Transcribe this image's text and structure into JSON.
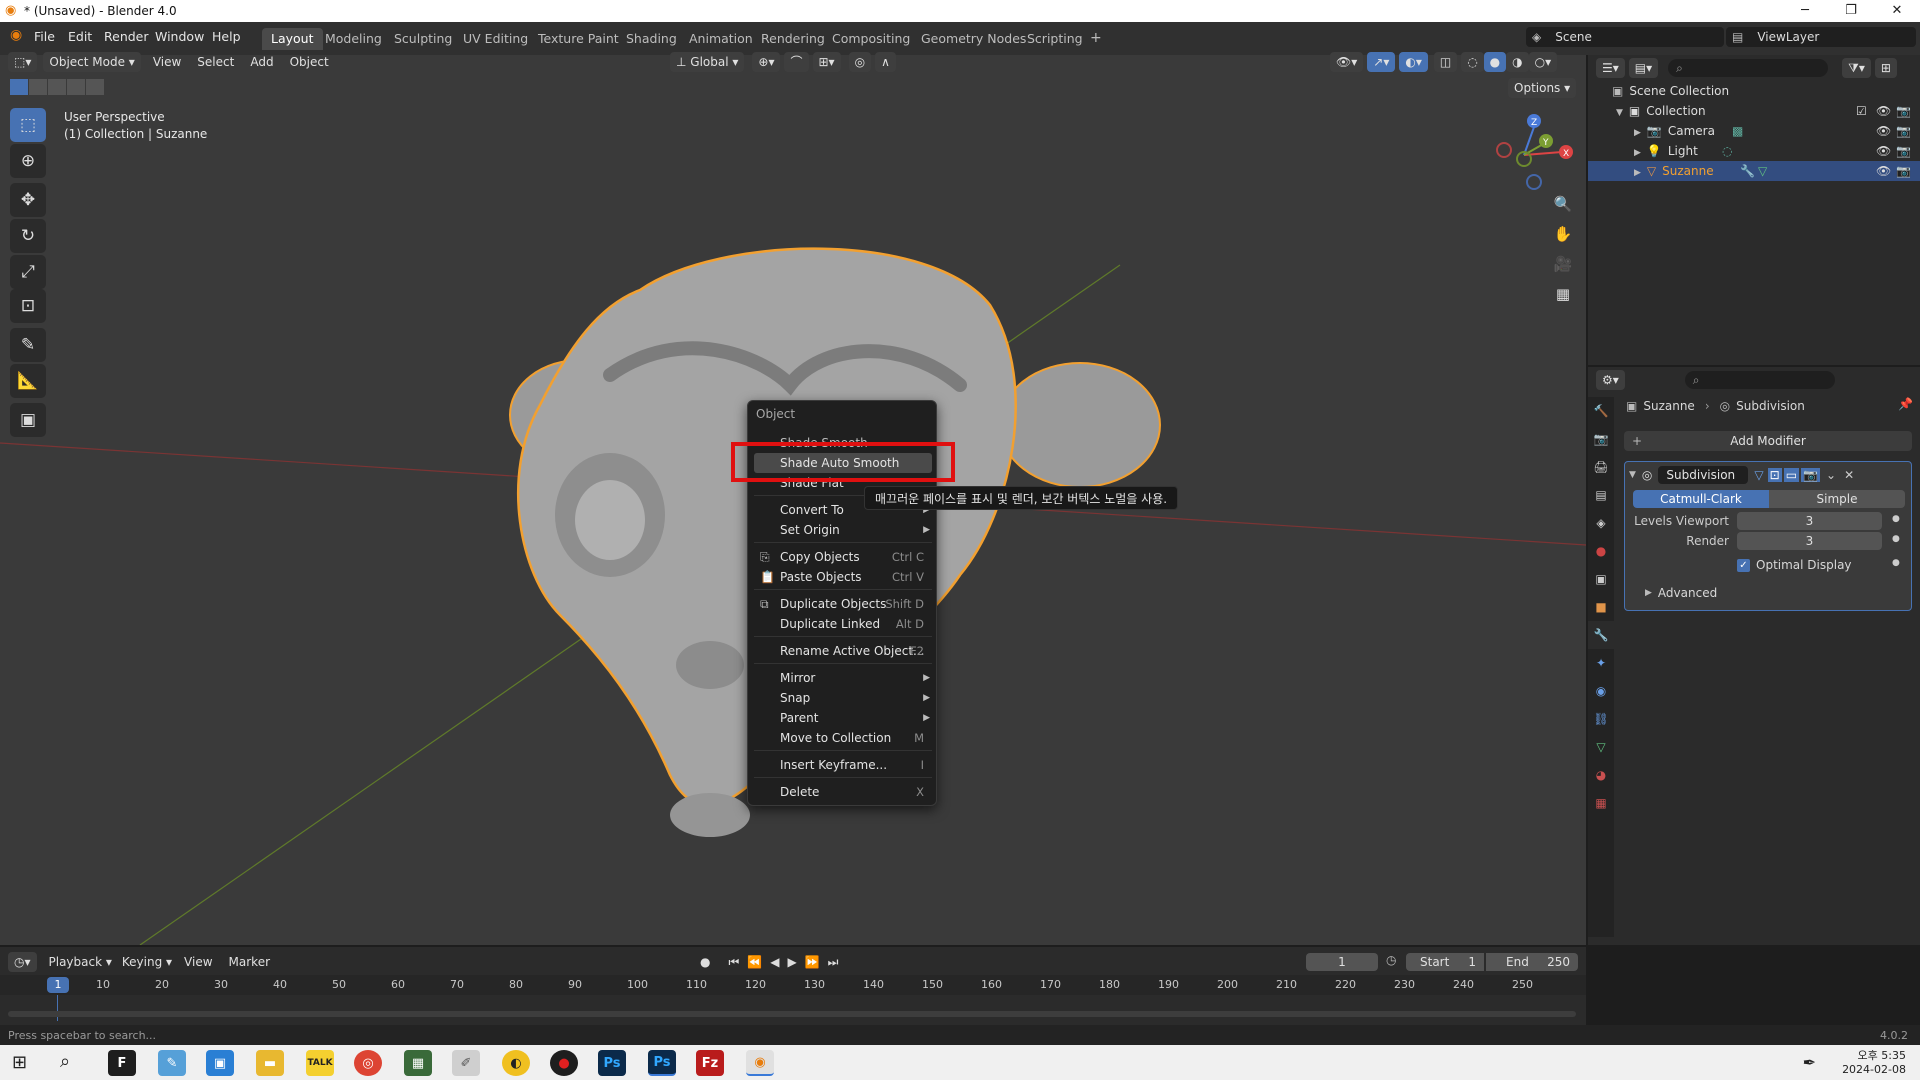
{
  "window": {
    "title": "* (Unsaved) - Blender 4.0"
  },
  "menu": [
    "File",
    "Edit",
    "Render",
    "Window",
    "Help"
  ],
  "workspaces": [
    "Layout",
    "Modeling",
    "Sculpting",
    "UV Editing",
    "Texture Paint",
    "Shading",
    "Animation",
    "Rendering",
    "Compositing",
    "Geometry Nodes",
    "Scripting"
  ],
  "active_workspace": "Layout",
  "scene": "Scene",
  "view_layer": "ViewLayer",
  "viewport": {
    "mode": "Object Mode",
    "menus": [
      "View",
      "Select",
      "Add",
      "Object"
    ],
    "orientation": "Global",
    "options": "Options",
    "info_line1": "User Perspective",
    "info_line2": "(1) Collection | Suzanne"
  },
  "context_menu": {
    "title": "Object",
    "items": [
      {
        "label": "Shade Smooth",
        "shortcut": ""
      },
      {
        "label": "Shade Auto Smooth",
        "shortcut": ""
      },
      {
        "label": "Shade Flat",
        "shortcut": ""
      },
      {
        "label": "Convert To",
        "shortcut": ""
      },
      {
        "label": "Set Origin",
        "shortcut": ""
      },
      {
        "label": "Copy Objects",
        "shortcut": "Ctrl C"
      },
      {
        "label": "Paste Objects",
        "shortcut": "Ctrl V"
      },
      {
        "label": "Duplicate Objects",
        "shortcut": "Shift D"
      },
      {
        "label": "Duplicate Linked",
        "shortcut": "Alt D"
      },
      {
        "label": "Rename Active Object...",
        "shortcut": "F2"
      },
      {
        "label": "Mirror",
        "shortcut": ""
      },
      {
        "label": "Snap",
        "shortcut": ""
      },
      {
        "label": "Parent",
        "shortcut": ""
      },
      {
        "label": "Move to Collection",
        "shortcut": "M"
      },
      {
        "label": "Insert Keyframe...",
        "shortcut": "I"
      },
      {
        "label": "Delete",
        "shortcut": "X"
      }
    ],
    "tooltip": "매끄러운 페이스를 표시 및 렌더, 보간 버텍스 노멀을 사용."
  },
  "outliner": {
    "root": "Scene Collection",
    "collection": "Collection",
    "objects": [
      "Camera",
      "Light",
      "Suzanne"
    ]
  },
  "properties": {
    "breadcrumb_object": "Suzanne",
    "breadcrumb_modifier": "Subdivision",
    "add_modifier": "Add Modifier",
    "modifier_name": "Subdivision",
    "type_a": "Catmull-Clark",
    "type_b": "Simple",
    "levels_viewport_label": "Levels Viewport",
    "levels_viewport": "3",
    "render_label": "Render",
    "render": "3",
    "optimal_display": "Optimal Display",
    "advanced": "Advanced"
  },
  "timeline": {
    "menus": [
      "Playback",
      "Keying",
      "View",
      "Marker"
    ],
    "current_frame": "1",
    "start_label": "Start",
    "start": "1",
    "end_label": "End",
    "end": "250",
    "ticks": [
      "10",
      "20",
      "30",
      "40",
      "50",
      "60",
      "70",
      "80",
      "90",
      "100",
      "110",
      "120",
      "130",
      "140",
      "150",
      "160",
      "170",
      "180",
      "190",
      "200",
      "210",
      "220",
      "230",
      "240",
      "250"
    ],
    "playhead": "1"
  },
  "status": {
    "hint": "Press spacebar to search...",
    "version": "4.0.2"
  },
  "taskbar": {
    "time": "오후 5:35",
    "date": "2024-02-08"
  },
  "colors": {
    "accent": "#4772b3",
    "selection_outline": "#f2a030",
    "highlight_box": "#e01010"
  }
}
